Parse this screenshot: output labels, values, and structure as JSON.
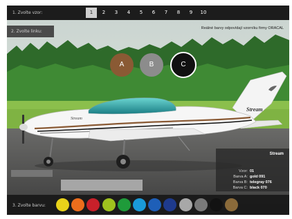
{
  "header": {
    "step1_label": "1. Zvolte vzor:",
    "patterns": [
      "1",
      "2",
      "3",
      "4",
      "5",
      "6",
      "7",
      "8",
      "9",
      "10"
    ],
    "active_pattern": "1"
  },
  "step2_label": "2. Zvolte linku:",
  "note": "Reálné barvy odpovídají vzorníku firmy ORACAL",
  "choices": [
    {
      "label": "A",
      "color": "#8a5a34"
    },
    {
      "label": "B",
      "color": "#8c8c8c"
    },
    {
      "label": "C",
      "color": "#111111"
    }
  ],
  "plane": {
    "name": "Stream"
  },
  "info": {
    "title": "Stream",
    "rows": [
      {
        "key": "Vzor:",
        "value": "01"
      },
      {
        "key": "Barva A:",
        "value": "gold 091"
      },
      {
        "key": "Barva B:",
        "value": "telegray 076"
      },
      {
        "key": "Barva C:",
        "value": "black 070"
      }
    ]
  },
  "step3_label": "3. Zvolte barvu:",
  "swatches": [
    "#e8d21a",
    "#ec6d1c",
    "#c8202a",
    "#9ec21e",
    "#1f9b3a",
    "#1a9ad8",
    "#1e5fb8",
    "#1e3a8c",
    "#a8a8a8",
    "#7a7a7a",
    "#121212",
    "#8a6a3a"
  ]
}
